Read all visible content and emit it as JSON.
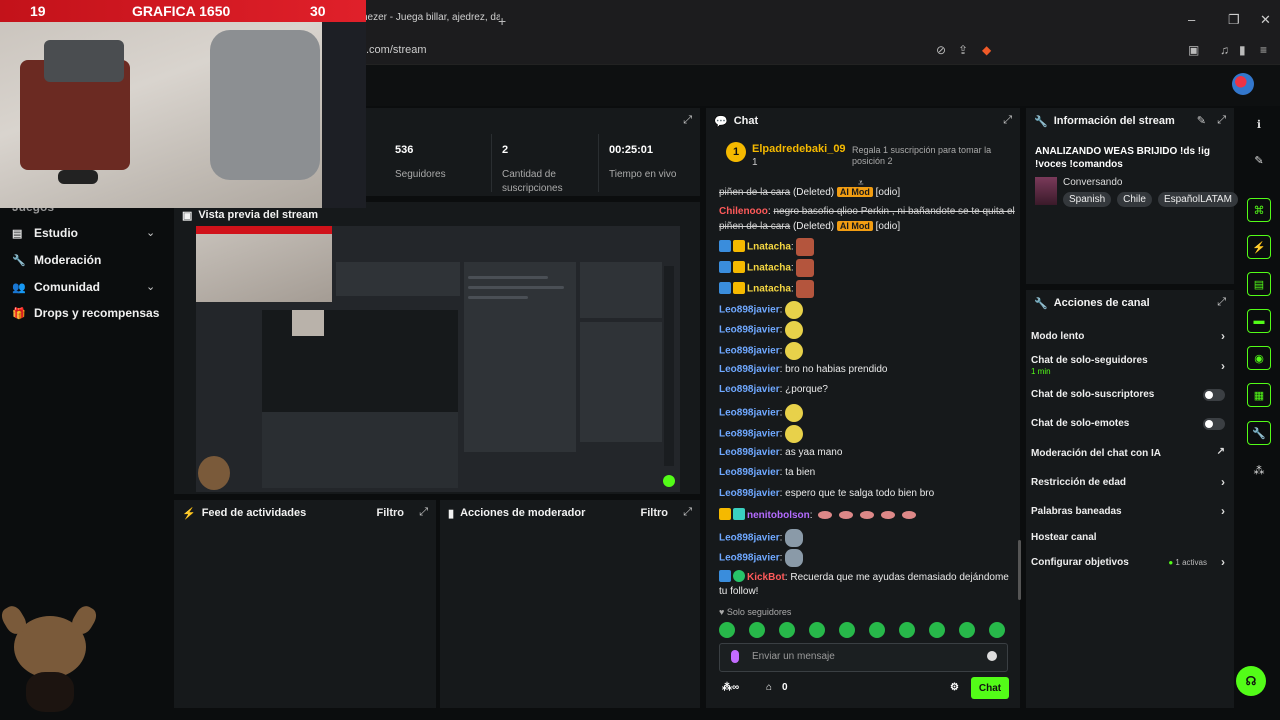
{
  "browser": {
    "tab_title": "nezer - Juega billar, ajedrez, dam",
    "new_tab": "+",
    "url": ".com/stream",
    "window_controls": [
      "–",
      "❐",
      "✕"
    ]
  },
  "webcam": {
    "left_number": "19",
    "title": "GRAFICA 1650",
    "right_number": "30"
  },
  "stats": [
    {
      "value": "536",
      "label": "Seguidores"
    },
    {
      "value": "2",
      "label": "Cantidad de suscripciones"
    },
    {
      "value": "00:25:01",
      "label": "Tiempo en vivo"
    }
  ],
  "sidebar": {
    "partial_item": "Juegos",
    "items": [
      {
        "label": "Estudio",
        "icon": "studio-icon",
        "chevron": true
      },
      {
        "label": "Moderación",
        "icon": "wrench-icon",
        "chevron": false
      },
      {
        "label": "Comunidad",
        "icon": "people-icon",
        "chevron": true
      },
      {
        "label": "Drops y recompensas",
        "icon": "gift-icon",
        "chevron": false
      }
    ]
  },
  "preview": {
    "title": "Vista previa del stream"
  },
  "feed": {
    "title": "Feed de actividades",
    "filter": "Filtro"
  },
  "modactions": {
    "title": "Acciones de moderador",
    "filter": "Filtro"
  },
  "chat": {
    "title": "Chat",
    "pinned": {
      "rank": "1",
      "user": "Elpadredebaki_09",
      "sub": "1",
      "note": "Regala 1 suscripción para tomar la posición 2"
    },
    "messages": [
      {
        "user": "",
        "text": "piñen de la cara",
        "deleted": "(Deleted)",
        "tag": "AI Mod",
        "extra": "[odio]"
      },
      {
        "user": "Chilenooo",
        "text": "negro basofio qlioo Perkin , ni bañandote se te quita el piñen de la cara",
        "deleted": "(Deleted)",
        "tag": "AI Mod",
        "extra": "[odio]"
      },
      {
        "user": "Lnatacha",
        "text": ""
      },
      {
        "user": "Lnatacha",
        "text": ""
      },
      {
        "user": "Lnatacha",
        "text": ""
      },
      {
        "user": "Leo898javier",
        "text": ""
      },
      {
        "user": "Leo898javier",
        "text": ""
      },
      {
        "user": "Leo898javier",
        "text": ""
      },
      {
        "user": "Leo898javier",
        "text": "bro no habias prendido"
      },
      {
        "user": "Leo898javier",
        "text": "¿porque?"
      },
      {
        "user": "Leo898javier",
        "text": ""
      },
      {
        "user": "Leo898javier",
        "text": ""
      },
      {
        "user": "Leo898javier",
        "text": "as yaa mano"
      },
      {
        "user": "Leo898javier",
        "text": "ta bien"
      },
      {
        "user": "Leo898javier",
        "text": "espero que te salga todo bien bro"
      },
      {
        "user": "nenitobolson",
        "text": ""
      },
      {
        "user": "Leo898javier",
        "text": ""
      },
      {
        "user": "Leo898javier",
        "text": ""
      },
      {
        "user": "KickBot",
        "text": "Recuerda que me ayudas demasiado dejándome tu follow!"
      }
    ],
    "solo": "Solo seguidores",
    "placeholder": "Enviar un mensaje",
    "points": "0",
    "send": "Chat"
  },
  "info": {
    "title": "Información del stream",
    "stream_title": "ANALIZANDO WEAS BRIJIDO !ds !ig !voces !comandos",
    "category": "Conversando",
    "tags": [
      "Spanish",
      "Chile",
      "EspañolLATAM"
    ]
  },
  "actions": {
    "title": "Acciones de canal",
    "items": [
      {
        "label": "Modo lento",
        "control": "chevron"
      },
      {
        "label": "Chat de solo-seguidores",
        "sub": "1 min",
        "control": "chevron"
      },
      {
        "label": "Chat de solo-suscriptores",
        "control": "toggle"
      },
      {
        "label": "Chat de solo-emotes",
        "control": "toggle"
      },
      {
        "label": "Moderación del chat con IA",
        "control": "external"
      },
      {
        "label": "Restricción de edad",
        "control": "chevron"
      },
      {
        "label": "Palabras baneadas",
        "control": "chevron"
      },
      {
        "label": "Hostear canal",
        "control": "none"
      },
      {
        "label": "Configurar objetivos",
        "badge": "1 activas",
        "control": "chevron"
      }
    ]
  },
  "colors": {
    "accent": "#53fc18",
    "mod_tag": "#f29d12",
    "username": "#6fa8ff"
  }
}
